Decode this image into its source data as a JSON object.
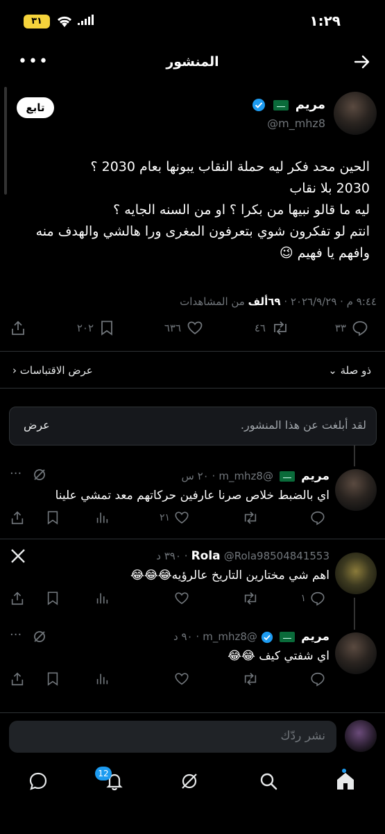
{
  "status_bar": {
    "time": "١:٢٩",
    "battery": "٣١"
  },
  "header": {
    "title": "المنشور"
  },
  "post": {
    "author_name": "مريم",
    "handle": "@m_mhz8",
    "follow_label": "تابع",
    "lines": [
      "الحين محد فكر ليه حملة النقاب يبونها بعام 2030 ؟",
      "2030 بلا نقاب",
      "ليه ما قالو نبيها من بكرا ؟ او من السنه الجايه ؟",
      "انتم لو تفكرون شوي بتعرفون المغرى ورا هالشي والهدف منه",
      "وافهم يا فهيم 😉"
    ],
    "meta_prefix": "٩:٤٤ م · ٢٠٢٦/٩/٢٩ ·",
    "views_count": "٦٩ألف",
    "views_label": "من المشاهدات",
    "replies": "٣٣",
    "reposts": "٤٦",
    "likes": "٦٣٦",
    "bookmarks": "٢٠٢"
  },
  "sort": {
    "label": "ذو صلة",
    "quotes": "عرض الاقتباسات"
  },
  "reported": {
    "text": "لقد أبلغت عن هذا المنشور.",
    "view": "عرض"
  },
  "replies": [
    {
      "name": "مريم",
      "handle": "@m_mhz8",
      "time": "٢٠ س",
      "text": "اي بالضبط خلاص صرنا عارفين حركاتهم معد تمشي علينا",
      "likes": "٢١",
      "replies": "",
      "bookmark_count": ""
    },
    {
      "name": "Rola",
      "handle": "@Rola98504841553",
      "time": "٣٩٠ د",
      "text": "اهم شي مختارين التاريخ عالرؤيه😂😂😂",
      "replies": "١",
      "likes": ""
    },
    {
      "name": "مريم",
      "handle": "@m_mhz8",
      "time": "٩٠ د",
      "text": "اي شفتي كيف 😂😂",
      "likes": ""
    }
  ],
  "compose": {
    "placeholder": "نشر ردّك"
  },
  "tabs": {
    "notifications_badge": "12"
  },
  "colors": {
    "accent": "#1d9bf0",
    "background": "#000000",
    "muted": "#71767b"
  }
}
